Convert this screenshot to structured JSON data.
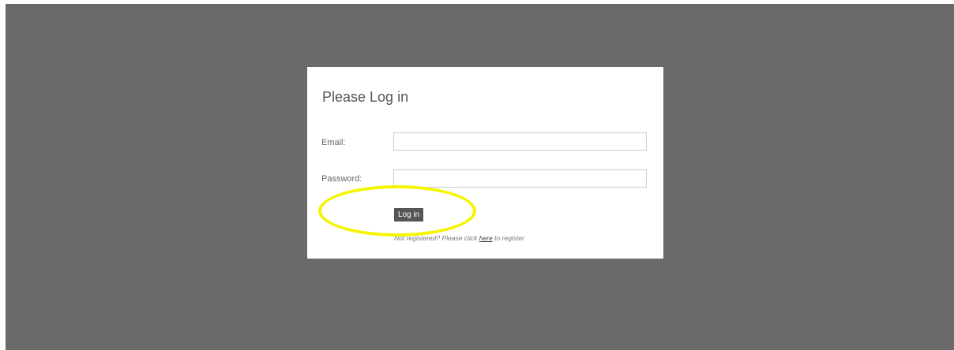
{
  "login_form": {
    "title": "Please Log in",
    "email_label": "Email:",
    "email_value": "",
    "password_label": "Password:",
    "password_value": "",
    "submit_label": "Log in",
    "register_prefix": "Not registered? Please click ",
    "register_link": "here",
    "register_suffix": " to register"
  },
  "colors": {
    "page_background": "#6a6a6a",
    "panel_background": "#ffffff",
    "button_background": "#555555",
    "highlight": "#f5f500"
  }
}
